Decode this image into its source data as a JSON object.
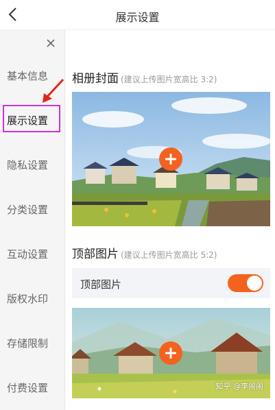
{
  "header": {
    "title": "展示设置"
  },
  "sidebar": {
    "items": [
      {
        "label": "基本信息"
      },
      {
        "label": "展示设置"
      },
      {
        "label": "隐私设置"
      },
      {
        "label": "分类设置"
      },
      {
        "label": "互动设置"
      },
      {
        "label": "版权水印"
      },
      {
        "label": "存储限制"
      },
      {
        "label": "付费设置"
      }
    ],
    "active_index": 1
  },
  "sections": {
    "cover": {
      "title": "相册封面",
      "hint": "(建议上传图片宽高比 3:2)"
    },
    "top_image": {
      "title": "顶部图片",
      "hint": "(建议上传图片宽高比 5:2)",
      "toggle_label": "顶部图片",
      "toggle_on": true
    }
  },
  "watermark": {
    "text": "知乎 @李闹闹"
  },
  "colors": {
    "accent": "#f4621f",
    "highlight": "#cf2fe0",
    "arrow": "#e2261c"
  },
  "icons": [
    "back-icon",
    "close-icon",
    "plus-icon",
    "arrow-icon"
  ]
}
